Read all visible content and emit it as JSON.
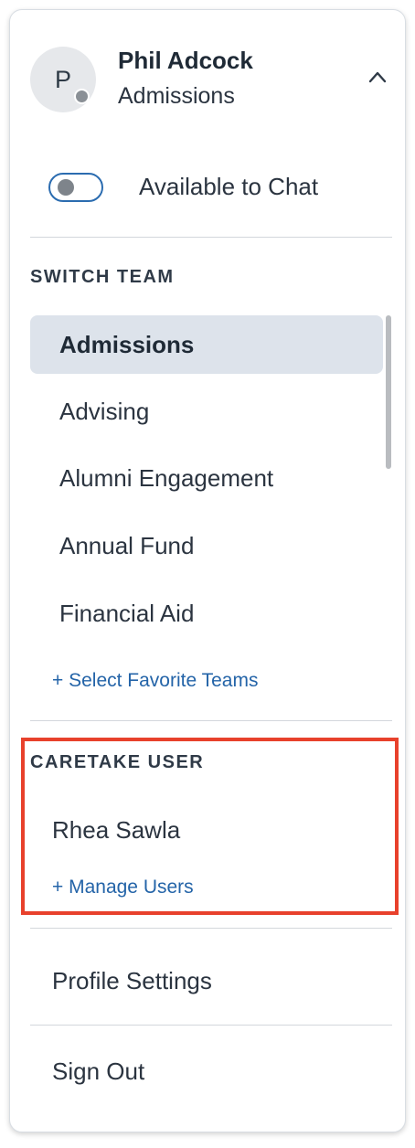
{
  "user": {
    "initial": "P",
    "name": "Phil Adcock",
    "team": "Admissions",
    "status_color": "#8a9096"
  },
  "header": {
    "chevron_icon": "chevron-up-icon"
  },
  "availability": {
    "label": "Available to Chat",
    "enabled": false,
    "accent_color": "#2b6cb0"
  },
  "switch_team": {
    "heading": "SWITCH TEAM",
    "teams": [
      {
        "label": "Admissions",
        "selected": true
      },
      {
        "label": "Advising",
        "selected": false
      },
      {
        "label": "Alumni Engagement",
        "selected": false
      },
      {
        "label": "Annual Fund",
        "selected": false
      },
      {
        "label": "Financial Aid",
        "selected": false
      }
    ],
    "select_favorites_link": "+ Select Favorite Teams"
  },
  "caretake": {
    "heading": "CARETAKE USER",
    "users": [
      "Rhea Sawla"
    ],
    "manage_link": "+ Manage Users",
    "highlight_color": "#e8412c"
  },
  "menu": {
    "profile_settings": "Profile Settings",
    "sign_out": "Sign Out"
  },
  "colors": {
    "link": "#2464a8",
    "selected_bg": "#dde3eb"
  }
}
